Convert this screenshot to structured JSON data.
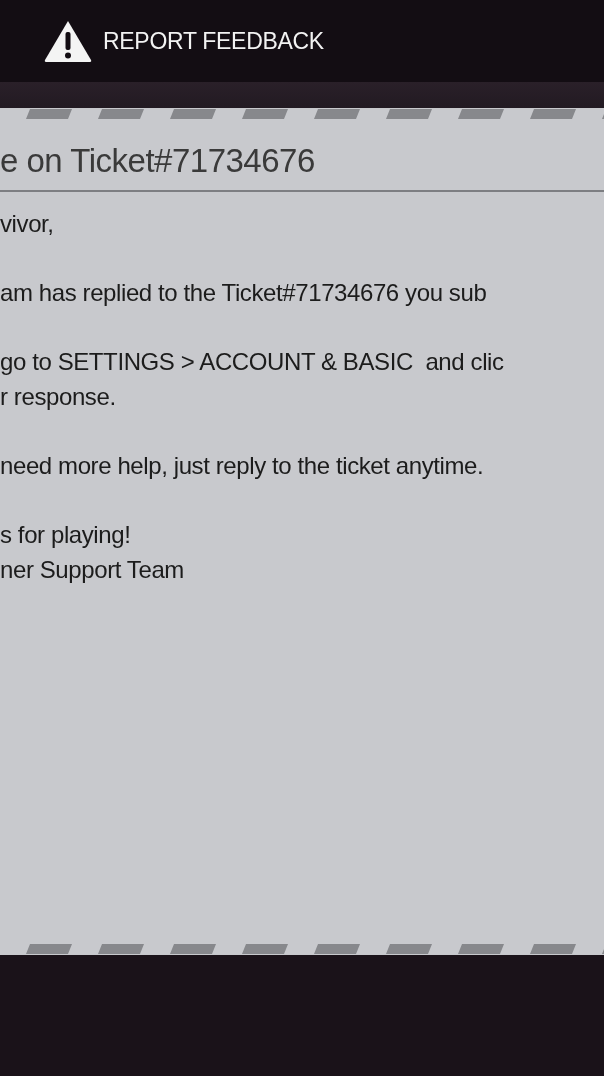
{
  "header": {
    "title": "REPORT FEEDBACK"
  },
  "message": {
    "subject": "e on Ticket#71734676",
    "paragraphs": [
      {
        "lines": [
          "vivor,"
        ]
      },
      {
        "lines": [
          "am has replied to the Ticket#71734676 you sub"
        ]
      },
      {
        "lines": [
          "go to SETTINGS > ACCOUNT & BASIC  and clic",
          "r response."
        ]
      },
      {
        "lines": [
          "need more help, just reply to the ticket anytime."
        ]
      },
      {
        "lines": [
          "s for playing!",
          "ner Support Team"
        ]
      }
    ]
  }
}
